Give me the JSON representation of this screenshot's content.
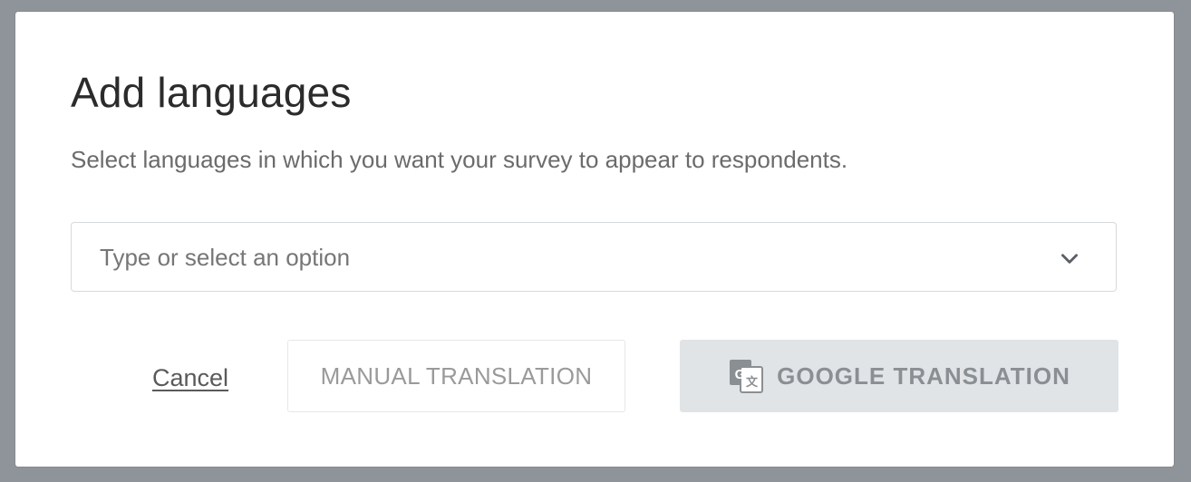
{
  "modal": {
    "title": "Add languages",
    "subtitle": "Select languages in which you want your survey to appear to respondents."
  },
  "language_select": {
    "placeholder": "Type or select an option"
  },
  "actions": {
    "cancel_label": "Cancel",
    "manual_label": "MANUAL TRANSLATION",
    "google_label": "GOOGLE TRANSLATION"
  },
  "icons": {
    "dropdown": "chevron-down-icon",
    "google_translate": "google-translate-icon"
  },
  "colors": {
    "overlay": "#8e9499",
    "modal_bg": "#ffffff",
    "google_button_bg": "#e1e4e6",
    "disabled_text": "#8a8f93"
  }
}
